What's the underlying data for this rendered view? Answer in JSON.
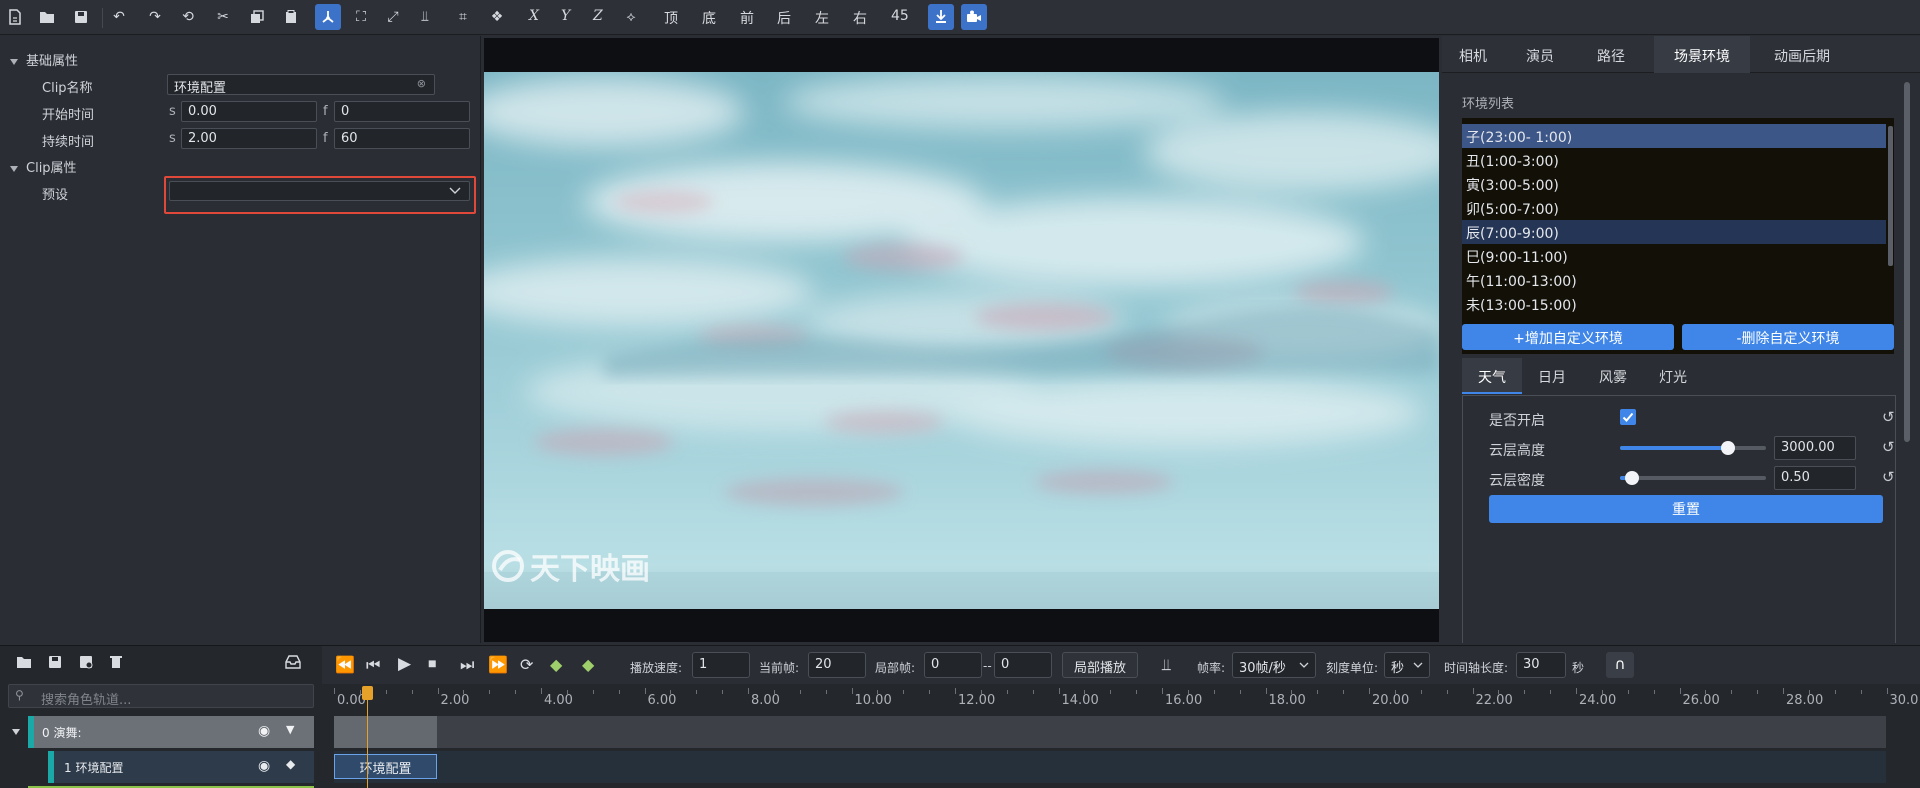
{
  "toolbar": {
    "view_labels": [
      "顶",
      "底",
      "前",
      "后",
      "左",
      "右"
    ],
    "angle": "45",
    "axes": [
      "X",
      "Y",
      "Z"
    ]
  },
  "left": {
    "section_basic": "基础属性",
    "clip_name_label": "Clip名称",
    "clip_name_value": "环境配置",
    "start_label": "开始时间",
    "start_s": "0.00",
    "start_f": "0",
    "duration_label": "持续时间",
    "duration_s": "2.00",
    "duration_f": "60",
    "unit_s": "s",
    "unit_f": "f",
    "section_clip": "Clip属性",
    "preset_label": "预设",
    "preset_value": ""
  },
  "viewport": {
    "watermark": "天下映画"
  },
  "right": {
    "tabs": [
      "相机",
      "演员",
      "路径",
      "场景环境",
      "动画后期"
    ],
    "active_tab": "场景环境",
    "env_list_title": "环境列表",
    "env_items": [
      "子(23:00- 1:00)",
      "丑(1:00-3:00)",
      "寅(3:00-5:00)",
      "卯(5:00-7:00)",
      "辰(7:00-9:00)",
      "巳(9:00-11:00)",
      "午(11:00-13:00)",
      "未(13:00-15:00)"
    ],
    "add_btn": "+增加自定义环境",
    "del_btn": "-删除自定义环境",
    "subtabs": [
      "天气",
      "日月",
      "风雾",
      "灯光"
    ],
    "weather": {
      "enabled_label": "是否开启",
      "enabled": true,
      "cloud_height_label": "云层高度",
      "cloud_height_value": "3000.00",
      "cloud_height_fraction": 0.74,
      "cloud_density_label": "云层密度",
      "cloud_density_value": "0.50",
      "cloud_density_fraction": 0.08,
      "reset_btn": "重置"
    }
  },
  "bottom": {
    "search_placeholder": "搜索角色轨道...",
    "speed_label": "播放速度:",
    "speed_value": "1",
    "frame_label": "当前帧:",
    "frame_value": "20",
    "local_label": "局部帧:",
    "local_from": "0",
    "local_sep": "--",
    "local_to": "0",
    "local_play_btn": "局部播放",
    "fps_label": "帧率:",
    "fps_value": "30帧/秒",
    "unit_label": "刻度单位:",
    "unit_value": "秒",
    "length_label": "时间轴长度:",
    "length_value": "30",
    "length_unit": "秒",
    "tracks": [
      {
        "name": "0 演舞:",
        "level": 0
      },
      {
        "name": "1 环境配置",
        "level": 1
      }
    ],
    "ruler": [
      "0.00",
      "2.00",
      "4.00",
      "6.00",
      "8.00",
      "10.00",
      "12.00",
      "14.00",
      "16.00",
      "18.00",
      "20.00",
      "22.00",
      "24.00",
      "26.00",
      "28.00",
      "30.0"
    ],
    "clip_label": "环境配置"
  },
  "colors": {
    "accent": "#3f86e8",
    "highlight_box": "#e0483a",
    "playhead": "#e6a12b"
  }
}
